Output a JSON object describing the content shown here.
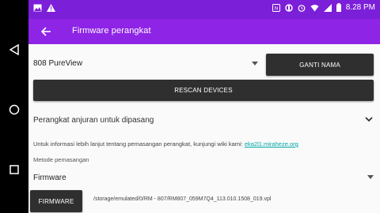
{
  "status_bar": {
    "time": "8.28 PM",
    "left_icons": [
      "image-icon",
      "warning-icon"
    ],
    "right_icons": [
      "nfc-icon",
      "sync-icon",
      "alarm-icon",
      "wifi-icon",
      "signal-icon",
      "battery-icon"
    ]
  },
  "app_bar": {
    "title": "Firmware perangkat"
  },
  "device": {
    "selected": "808 PureView"
  },
  "buttons": {
    "rename": "GANTI NAMA",
    "rescan": "RESCAN DEVICES",
    "firmware": "FIRMWARE"
  },
  "recommended": {
    "label": "Perangkat anjuran untuk dipasang"
  },
  "info": {
    "text": "Untuk informasi lebih lanjut tentang pemasangan perangkat, kunjungi wiki kami: ",
    "link": "eka2l1.miraheze.org"
  },
  "method": {
    "label": "Metode pemasangan",
    "selected": "Firmware"
  },
  "firmware": {
    "path": "/storage/emulated/0/RM - 807/RM807_059M7Q4_113.010.1508_019.vpl"
  },
  "colors": {
    "status_bar": "#7b1fd8",
    "app_bar": "#8e24e6",
    "button_dark": "#2f2f2f",
    "link": "#00a6a6"
  }
}
